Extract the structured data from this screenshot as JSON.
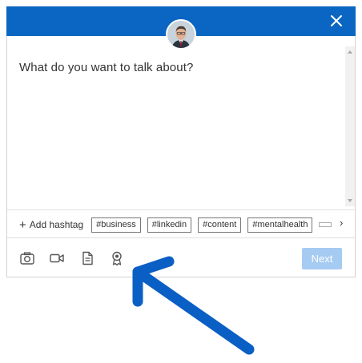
{
  "composer": {
    "placeholder": "What do you want to talk about?",
    "add_hashtag_label": "Add hashtag",
    "hashtags": [
      "#business",
      "#linkedin",
      "#content",
      "#mentalhealth"
    ],
    "next_label": "Next"
  },
  "colors": {
    "header": "#0a66c2",
    "next_button_disabled": "#a6cbf2",
    "annotation_arrow": "#0a5fc4"
  },
  "icons": {
    "close": "close-icon",
    "photo": "camera-icon",
    "video": "video-camera-icon",
    "document": "document-icon",
    "celebrate": "award-ribbon-icon",
    "hashtag_scroll": "chevron-right-icon"
  }
}
